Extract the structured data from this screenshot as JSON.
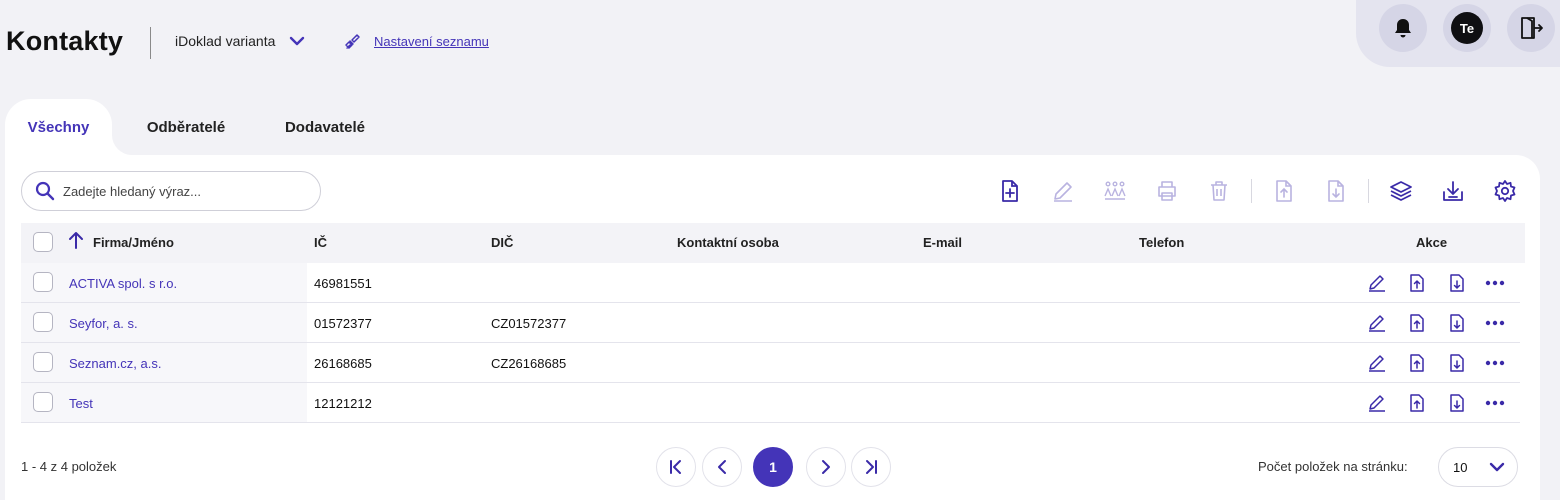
{
  "header": {
    "title": "Kontakty",
    "variant_label": "iDoklad varianta",
    "list_settings_label": "Nastavení seznamu",
    "avatar_initials": "Te"
  },
  "tabs": [
    {
      "label": "Všechny",
      "active": true
    },
    {
      "label": "Odběratelé",
      "active": false
    },
    {
      "label": "Dodavatelé",
      "active": false
    }
  ],
  "search": {
    "placeholder": "Zadejte hledaný výraz...",
    "value": ""
  },
  "toolbar": {
    "icons": [
      "new-document-icon",
      "edit-icon",
      "bulk-edit-icon",
      "print-icon",
      "delete-icon",
      "export-icon",
      "import-icon",
      "layers-icon",
      "download-icon",
      "settings-icon"
    ],
    "disabled": [
      "edit-icon",
      "bulk-edit-icon",
      "print-icon",
      "delete-icon",
      "export-icon",
      "import-icon"
    ]
  },
  "table": {
    "columns": [
      "Firma/Jméno",
      "IČ",
      "DIČ",
      "Kontaktní osoba",
      "E-mail",
      "Telefon",
      "Akce"
    ],
    "sort": {
      "column": "Firma/Jméno",
      "direction": "ascending"
    },
    "rows": [
      {
        "name": "ACTIVA spol. s r.o.",
        "ic": "46981551",
        "dic": "",
        "contact": "",
        "email": "",
        "phone": ""
      },
      {
        "name": "Seyfor, a. s.",
        "ic": "01572377",
        "dic": "CZ01572377",
        "contact": "",
        "email": "",
        "phone": ""
      },
      {
        "name": "Seznam.cz, a.s.",
        "ic": "26168685",
        "dic": "CZ26168685",
        "contact": "",
        "email": "",
        "phone": ""
      },
      {
        "name": "Test",
        "ic": "12121212",
        "dic": "",
        "contact": "",
        "email": "",
        "phone": ""
      }
    ],
    "row_actions": [
      "edit-icon",
      "export-icon",
      "import-icon",
      "more-icon"
    ]
  },
  "pagination": {
    "summary": "1 - 4 z 4 položek",
    "current_page": "1",
    "per_page_label": "Počet položek na stránku:",
    "per_page_value": "10"
  },
  "colors": {
    "accent": "#4434b8",
    "background": "#f2f2f6",
    "header_bg": "#f3f3f7"
  }
}
